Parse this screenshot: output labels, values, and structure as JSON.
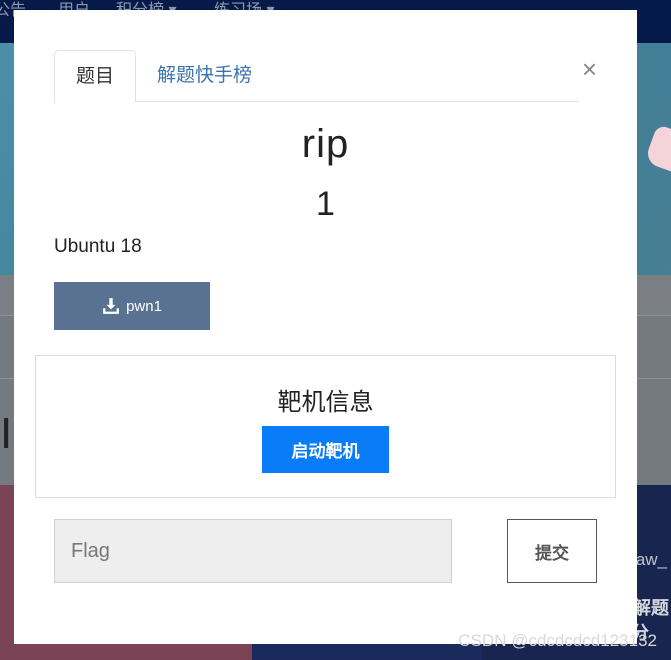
{
  "background": {
    "nav": [
      "公告",
      "用户",
      "积分榜 ▾",
      "练习场 ▾"
    ],
    "big_letter": "I",
    "card_texts": [
      "saw_",
      "欢解题",
      "分"
    ]
  },
  "modal": {
    "close": "×",
    "tabs": [
      {
        "label": "题目",
        "active": true
      },
      {
        "label": "解题快手榜",
        "active": false
      }
    ],
    "challenge": {
      "name": "rip",
      "value": "1",
      "description": "Ubuntu 18"
    },
    "download": {
      "label": "pwn1",
      "icon": "download-icon"
    },
    "target": {
      "title": "靶机信息",
      "start_button": "启动靶机"
    },
    "flag": {
      "placeholder": "Flag",
      "value": ""
    },
    "submit_button": "提交"
  },
  "watermark": "CSDN @cdcdcdcd123132",
  "colors": {
    "download_button": "#5a7292",
    "start_button": "#0a7cf8",
    "tab_link": "#3a74ad"
  }
}
